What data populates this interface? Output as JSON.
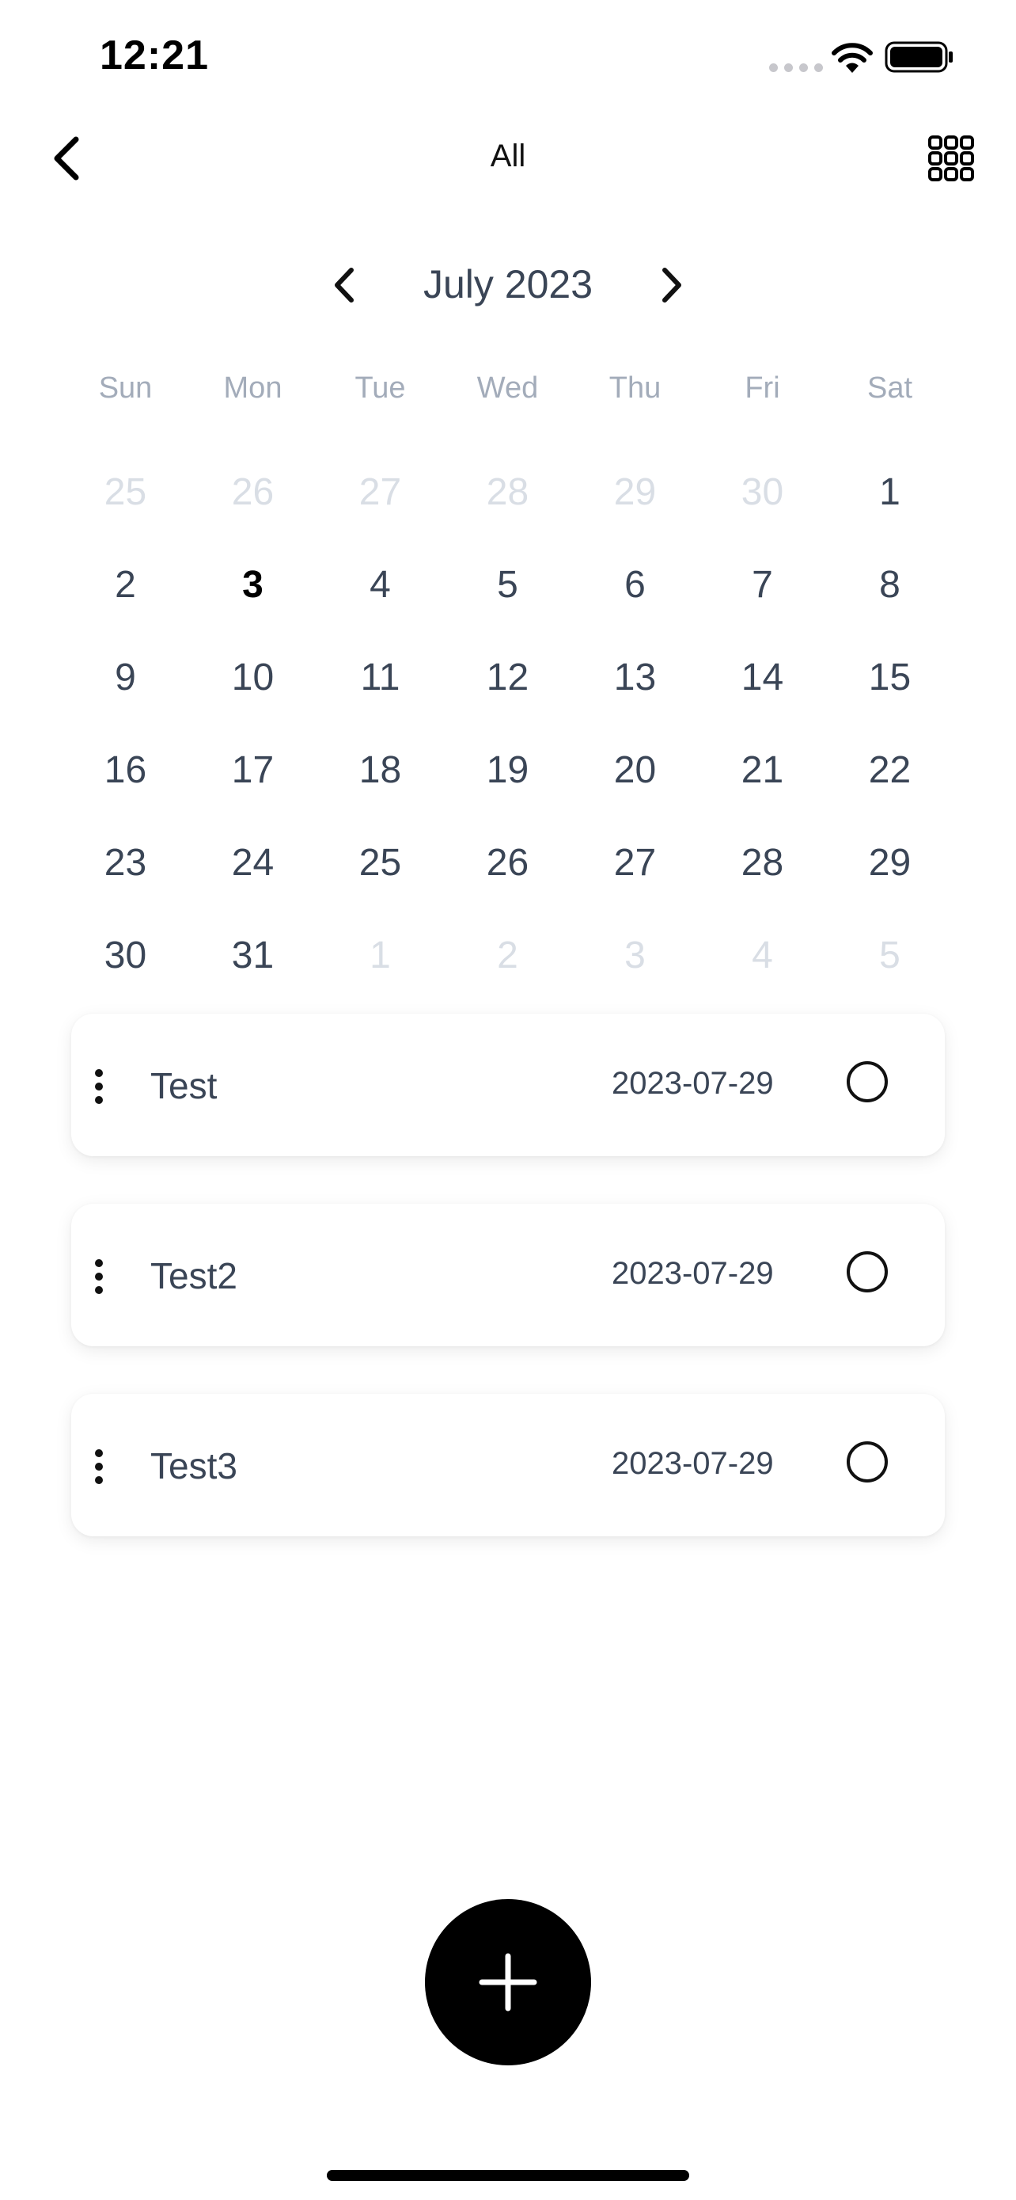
{
  "status_bar": {
    "time": "12:21"
  },
  "nav": {
    "title": "All",
    "back_icon": "chevron-left-icon",
    "grid_icon": "grid-icon"
  },
  "calendar": {
    "month_label": "July 2023",
    "weekdays": [
      "Sun",
      "Mon",
      "Tue",
      "Wed",
      "Thu",
      "Fri",
      "Sat"
    ],
    "weeks": [
      [
        {
          "d": "25",
          "m": true
        },
        {
          "d": "26",
          "m": true
        },
        {
          "d": "27",
          "m": true
        },
        {
          "d": "28",
          "m": true
        },
        {
          "d": "29",
          "m": true
        },
        {
          "d": "30",
          "m": true
        },
        {
          "d": "1"
        }
      ],
      [
        {
          "d": "2"
        },
        {
          "d": "3",
          "t": true
        },
        {
          "d": "4"
        },
        {
          "d": "5"
        },
        {
          "d": "6"
        },
        {
          "d": "7"
        },
        {
          "d": "8"
        }
      ],
      [
        {
          "d": "9"
        },
        {
          "d": "10"
        },
        {
          "d": "11"
        },
        {
          "d": "12"
        },
        {
          "d": "13"
        },
        {
          "d": "14"
        },
        {
          "d": "15"
        }
      ],
      [
        {
          "d": "16"
        },
        {
          "d": "17"
        },
        {
          "d": "18"
        },
        {
          "d": "19"
        },
        {
          "d": "20"
        },
        {
          "d": "21"
        },
        {
          "d": "22"
        }
      ],
      [
        {
          "d": "23"
        },
        {
          "d": "24"
        },
        {
          "d": "25"
        },
        {
          "d": "26"
        },
        {
          "d": "27"
        },
        {
          "d": "28"
        },
        {
          "d": "29"
        }
      ],
      [
        {
          "d": "30"
        },
        {
          "d": "31"
        },
        {
          "d": "1",
          "m": true
        },
        {
          "d": "2",
          "m": true
        },
        {
          "d": "3",
          "m": true
        },
        {
          "d": "4",
          "m": true
        },
        {
          "d": "5",
          "m": true
        }
      ]
    ]
  },
  "tasks": [
    {
      "title": "Test",
      "date": "2023-07-29",
      "done": false
    },
    {
      "title": "Test2",
      "date": "2023-07-29",
      "done": false
    },
    {
      "title": "Test3",
      "date": "2023-07-29",
      "done": false
    }
  ],
  "fab": {
    "icon": "plus-icon"
  },
  "colors": {
    "text": "#3a4556",
    "muted": "#d9dee5",
    "weekday": "#a3acba",
    "accent": "#000000"
  }
}
